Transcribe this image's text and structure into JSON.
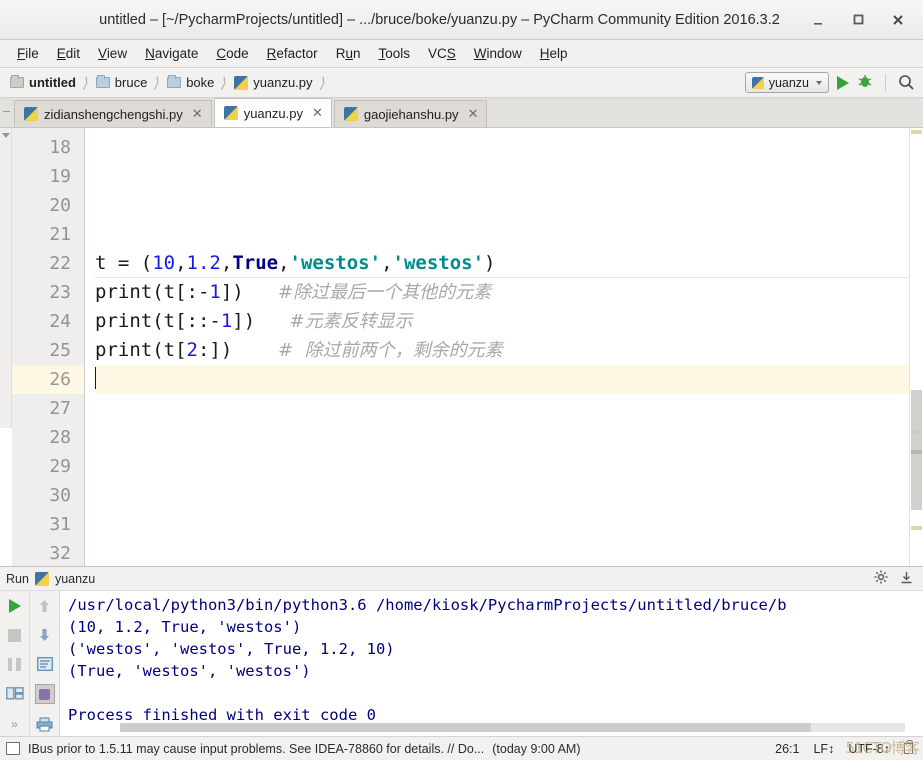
{
  "window": {
    "title": "untitled – [~/PycharmProjects/untitled] – .../bruce/boke/yuanzu.py – PyCharm Community Edition 2016.3.2",
    "minimize_label": "‒",
    "maximize_label": "□",
    "close_label": "✕"
  },
  "menubar": {
    "items": [
      {
        "label": "File",
        "mnemonic": "F"
      },
      {
        "label": "Edit",
        "mnemonic": "E"
      },
      {
        "label": "View",
        "mnemonic": "V"
      },
      {
        "label": "Navigate",
        "mnemonic": "N"
      },
      {
        "label": "Code",
        "mnemonic": "C"
      },
      {
        "label": "Refactor",
        "mnemonic": "R"
      },
      {
        "label": "Run",
        "mnemonic": "u"
      },
      {
        "label": "Tools",
        "mnemonic": "T"
      },
      {
        "label": "VCS",
        "mnemonic": "S"
      },
      {
        "label": "Window",
        "mnemonic": "W"
      },
      {
        "label": "Help",
        "mnemonic": "H"
      }
    ]
  },
  "breadcrumb": {
    "items": [
      {
        "label": "untitled",
        "icon": "folder-icon",
        "bold": true
      },
      {
        "label": "bruce",
        "icon": "folder-icon",
        "bold": false
      },
      {
        "label": "boke",
        "icon": "folder-icon",
        "bold": false
      },
      {
        "label": "yuanzu.py",
        "icon": "python-file-icon",
        "bold": false
      }
    ],
    "separator": "❯"
  },
  "toolbar_right": {
    "run_configuration": "yuanzu",
    "run_button": "run-icon",
    "debug_button": "debug-icon",
    "search_button": "search-icon"
  },
  "tabs": [
    {
      "label": "zidianshengchengshi.py",
      "active": false,
      "close": "✕"
    },
    {
      "label": "yuanzu.py",
      "active": true,
      "close": "✕"
    },
    {
      "label": "gaojiehanshu.py",
      "active": false,
      "close": "✕"
    }
  ],
  "editor": {
    "first_line_number": 18,
    "current_line": 26,
    "line_numbers": [
      18,
      19,
      20,
      21,
      22,
      23,
      24,
      25,
      26,
      27,
      28,
      29,
      30,
      31,
      32
    ],
    "lines": [
      {
        "n": 18,
        "tokens": []
      },
      {
        "n": 19,
        "tokens": []
      },
      {
        "n": 20,
        "tokens": []
      },
      {
        "n": 21,
        "tokens": []
      },
      {
        "n": 22,
        "tokens": [
          {
            "t": "plain",
            "v": "t = ("
          },
          {
            "t": "num",
            "v": "10"
          },
          {
            "t": "plain",
            "v": ","
          },
          {
            "t": "num",
            "v": "1.2"
          },
          {
            "t": "plain",
            "v": ","
          },
          {
            "t": "kw",
            "v": "True"
          },
          {
            "t": "plain",
            "v": ","
          },
          {
            "t": "str",
            "v": "'westos'"
          },
          {
            "t": "plain",
            "v": ","
          },
          {
            "t": "str",
            "v": "'westos'"
          },
          {
            "t": "plain",
            "v": ")"
          }
        ]
      },
      {
        "n": 23,
        "tokens": [
          {
            "t": "plain",
            "v": "print(t[:-"
          },
          {
            "t": "num",
            "v": "1"
          },
          {
            "t": "plain",
            "v": "])   "
          },
          {
            "t": "com",
            "v": "#除过最后一个其他的元素"
          }
        ]
      },
      {
        "n": 24,
        "tokens": [
          {
            "t": "plain",
            "v": "print(t[::-"
          },
          {
            "t": "num",
            "v": "1"
          },
          {
            "t": "plain",
            "v": "])   "
          },
          {
            "t": "com",
            "v": "#元素反转显示"
          }
        ]
      },
      {
        "n": 25,
        "tokens": [
          {
            "t": "plain",
            "v": "print(t["
          },
          {
            "t": "num",
            "v": "2"
          },
          {
            "t": "plain",
            "v": ":])    "
          },
          {
            "t": "com",
            "v": "#  除过前两个，剩余的元素"
          }
        ]
      },
      {
        "n": 26,
        "tokens": [],
        "caret": true
      },
      {
        "n": 27,
        "tokens": []
      },
      {
        "n": 28,
        "tokens": []
      },
      {
        "n": 29,
        "tokens": []
      },
      {
        "n": 30,
        "tokens": []
      },
      {
        "n": 31,
        "tokens": []
      },
      {
        "n": 32,
        "tokens": []
      }
    ]
  },
  "run_panel": {
    "title": "Run",
    "config_name": "yuanzu",
    "settings_icon": "gear-icon",
    "hide_icon": "hide-icon",
    "toolbar_left": [
      {
        "name": "rerun-icon"
      },
      {
        "name": "stop-icon"
      },
      {
        "name": "pause-icon"
      },
      {
        "name": "layout-icon"
      },
      {
        "name": "expand-more-icon"
      }
    ],
    "toolbar_right": [
      {
        "name": "scroll-up-icon"
      },
      {
        "name": "scroll-down-icon"
      },
      {
        "name": "soft-wrap-icon"
      },
      {
        "name": "scroll-to-end-icon"
      },
      {
        "name": "print-icon"
      },
      {
        "name": "expand-more-icon"
      }
    ],
    "console_lines": [
      "/usr/local/python3/bin/python3.6 /home/kiosk/PycharmProjects/untitled/bruce/b",
      "(10, 1.2, True, 'westos')",
      "('westos', 'westos', True, 1.2, 10)",
      "(True, 'westos', 'westos')",
      "",
      "Process finished with exit code 0"
    ]
  },
  "statusbar": {
    "icon": "event-log-icon",
    "message": "IBus prior to 1.5.11 may cause input problems. See IDEA-78860 for details. // Do...",
    "time": "(today 9:00 AM)",
    "caret_position": "26:1",
    "line_separator": "LF↕",
    "encoding": "UTF-8↕",
    "lock_icon": "lock-icon",
    "watermark": "51CTO博客"
  },
  "colors": {
    "number": "#1a1ae6",
    "keyword": "#000080",
    "string": "#008c8c",
    "comment": "#a8a8a8",
    "console_text": "#00007f",
    "current_line_bg": "#fcf8e4",
    "accent_green": "#36a436"
  }
}
